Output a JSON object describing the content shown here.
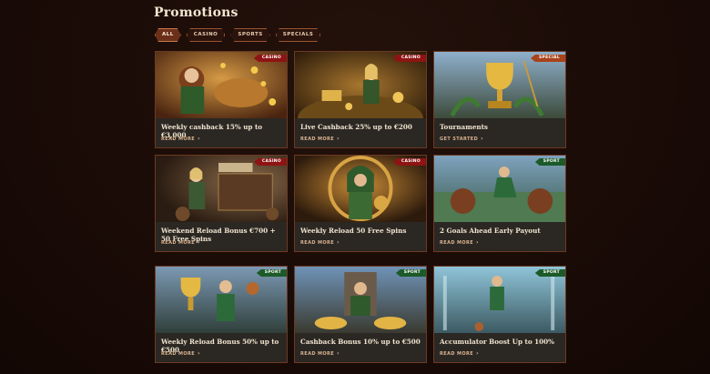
{
  "page": {
    "title": "Promotions"
  },
  "filters": [
    {
      "label": "ALL",
      "active": true
    },
    {
      "label": "CASINO",
      "active": false
    },
    {
      "label": "SPORTS",
      "active": false
    },
    {
      "label": "SPECIALS",
      "active": false
    }
  ],
  "colors": {
    "casino": "#8e1414",
    "special": "#a8431b",
    "sport": "#1c5a2a",
    "card_bg": "#2b2723",
    "card_border": "#6c3a24"
  },
  "cards": [
    {
      "badge": "CASINO",
      "title": "Weekly cashback 15% up to €3,000",
      "cta": "READ MORE",
      "icon": "chevron-right-icon"
    },
    {
      "badge": "CASINO",
      "title": "Live Cashback 25% up to €200",
      "cta": "READ MORE",
      "icon": "chevron-right-icon"
    },
    {
      "badge": "SPECIAL",
      "title": "Tournaments",
      "cta": "GET STARTED",
      "icon": "chevron-right-icon"
    },
    {
      "badge": "CASINO",
      "title": "Weekend Reload Bonus €700 + 50 Free Spins",
      "cta": "READ MORE",
      "icon": "chevron-right-icon"
    },
    {
      "badge": "CASINO",
      "title": "Weekly Reload 50 Free Spins",
      "cta": "READ MORE",
      "icon": "chevron-right-icon"
    },
    {
      "badge": "SPORT",
      "title": "2 Goals Ahead Early Payout",
      "cta": "READ MORE",
      "icon": "chevron-right-icon"
    },
    {
      "badge": "SPORT",
      "title": "Weekly Reload Bonus 50% up to €500",
      "cta": "READ MORE",
      "icon": "chevron-right-icon"
    },
    {
      "badge": "SPORT",
      "title": "Cashback Bonus 10% up to €500",
      "cta": "READ MORE",
      "icon": "chevron-right-icon"
    },
    {
      "badge": "SPORT",
      "title": "Accumulator Boost Up to 100%",
      "cta": "READ MORE",
      "icon": "chevron-right-icon"
    }
  ]
}
